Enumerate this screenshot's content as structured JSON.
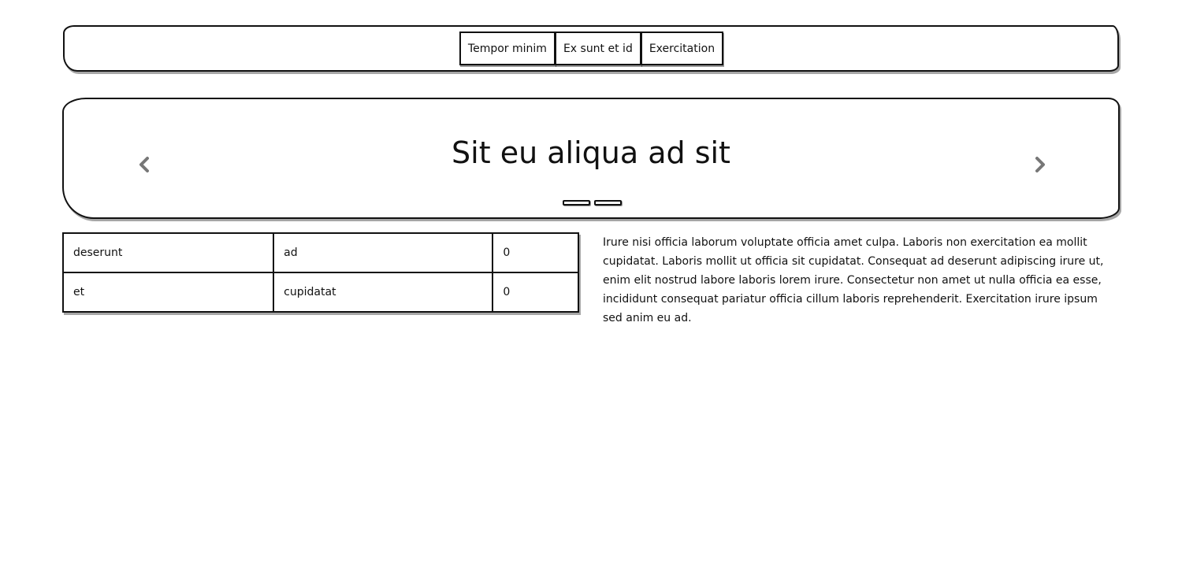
{
  "nav": {
    "buttons": [
      "Tempor minim",
      "Ex sunt et id",
      "Exercitation"
    ]
  },
  "carousel": {
    "title": "Sit eu aliqua ad sit",
    "prev_icon": "chevron-left-icon",
    "next_icon": "chevron-right-icon",
    "indicator_count": 2
  },
  "table": {
    "rows": [
      [
        "deserunt",
        "ad",
        "0"
      ],
      [
        "et",
        "cupidatat",
        "0"
      ]
    ]
  },
  "paragraph": {
    "text": "Irure nisi officia laborum voluptate officia amet culpa. Laboris non exercitation ea mollit cupidatat. Laboris mollit ut officia sit cupidatat. Consequat ad deserunt adipiscing irure ut, enim elit nostrud labore laboris lorem irure. Consectetur non amet ut nulla officia ea esse, incididunt consequat pariatur officia cillum laboris reprehenderit. Exercitation irure ipsum sed anim eu ad."
  },
  "colors": {
    "ink": "#111111",
    "arrow": "#777777",
    "background": "#ffffff"
  }
}
